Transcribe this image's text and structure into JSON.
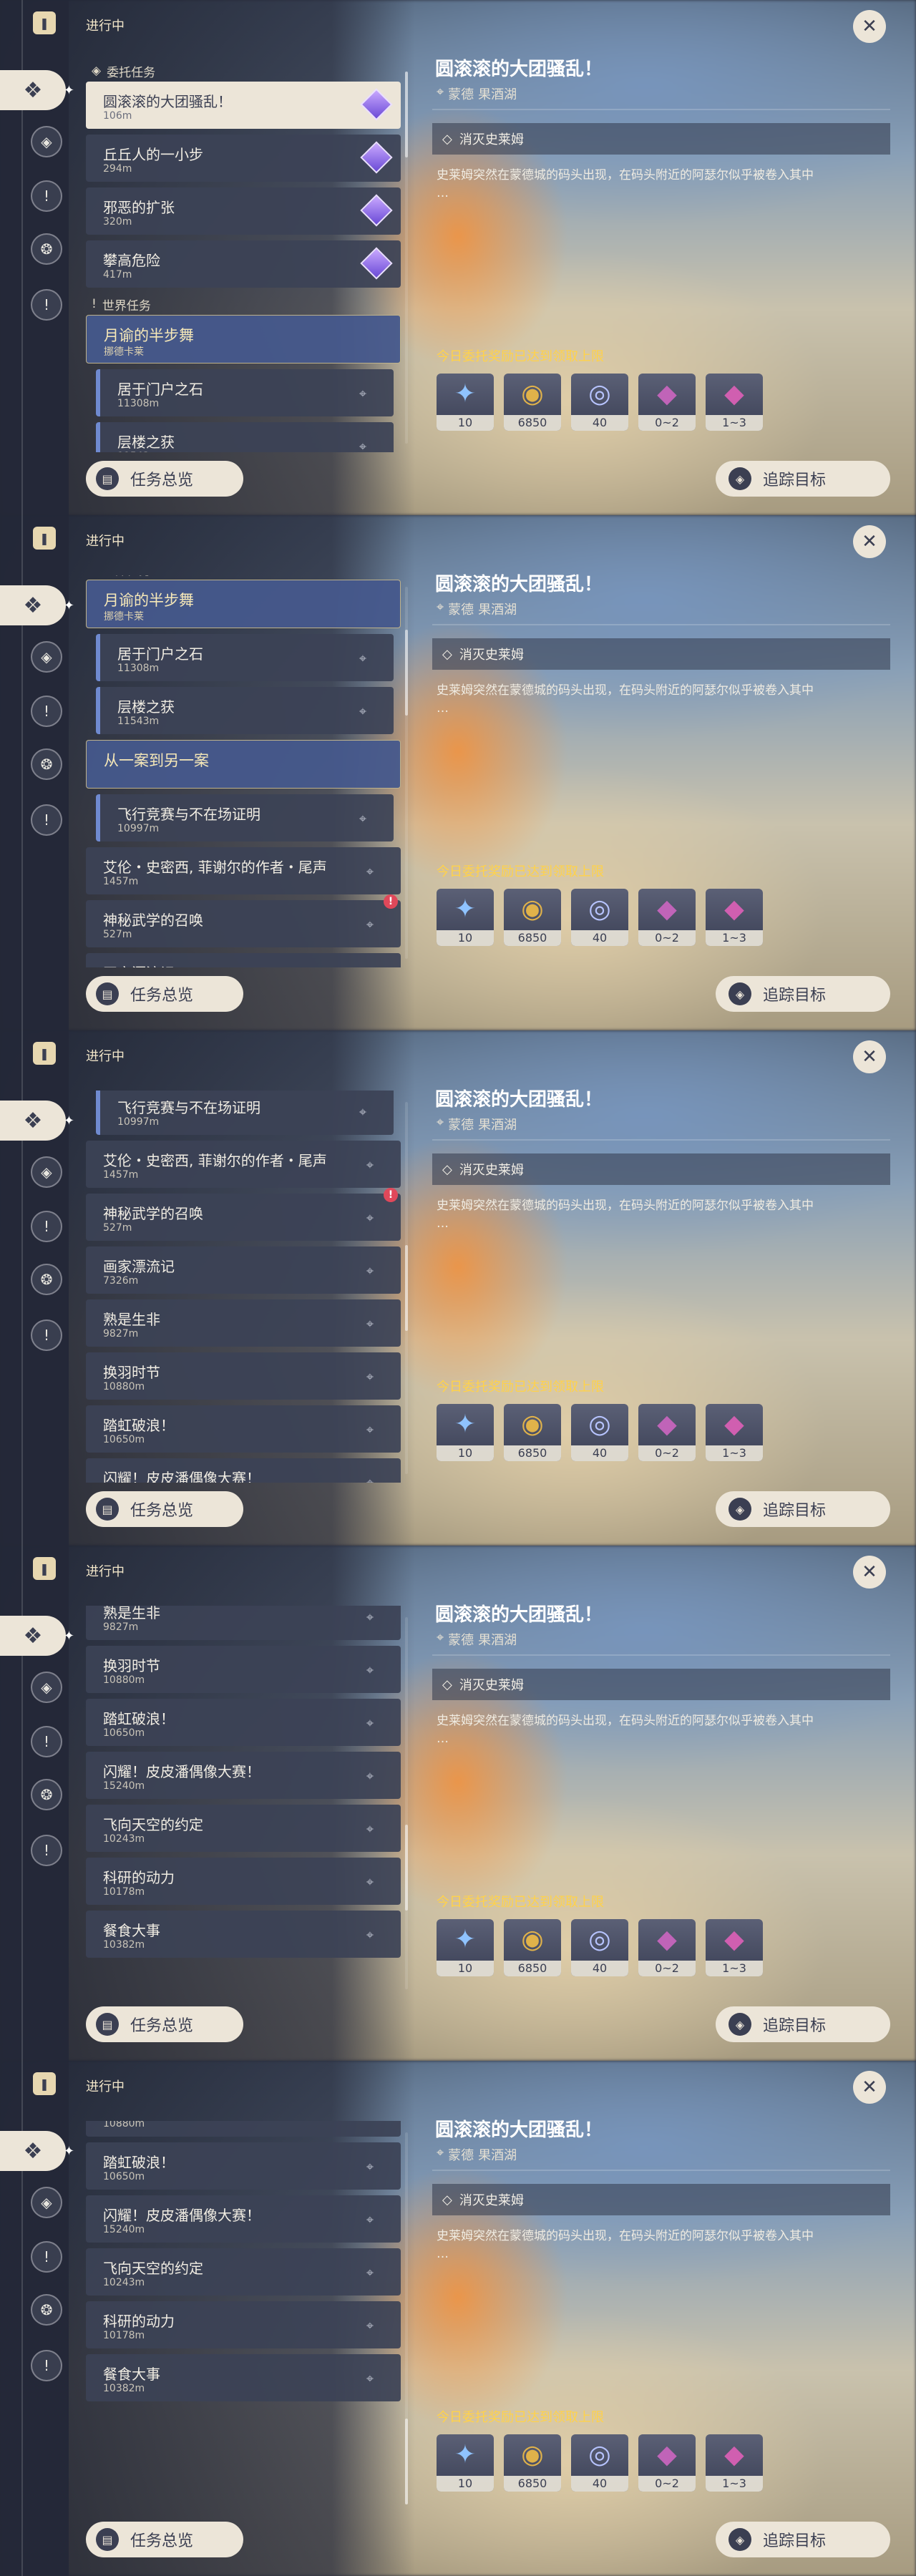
{
  "header": {
    "in_progress": "进行中",
    "close_glyph": "✕"
  },
  "rail_icons": [
    "quest-book-icon",
    "commission-icon",
    "compass-icon",
    "exclamation-icon",
    "diamond-gear-icon",
    "world-quest-icon"
  ],
  "buttons": {
    "overview": "任务总览",
    "track": "追踪目标"
  },
  "detail": {
    "title": "圆滚滚的大团骚乱！",
    "region": "蒙德",
    "place": "果酒湖",
    "objective": "消灭史莱姆",
    "description": "史莱姆突然在蒙德城的码头出现，在码头附近的阿瑟尔似乎被卷入其中",
    "description_more": "…",
    "reward_title": "今日委托奖励已达到领取上限",
    "rewards": [
      {
        "name": "adventure-exp-icon",
        "count": "10"
      },
      {
        "name": "mora-icon",
        "count": "6850"
      },
      {
        "name": "companionship-exp-icon",
        "count": "40"
      },
      {
        "name": "ore-icon",
        "count": "0~2"
      },
      {
        "name": "crystal-icon",
        "count": "1~3"
      }
    ]
  },
  "quests": {
    "commission_header": "委托任务",
    "world_header": "世界任务",
    "commission": [
      {
        "title": "圆滚滚的大团骚乱！",
        "dist": "106m"
      },
      {
        "title": "丘丘人的一小步",
        "dist": "294m"
      },
      {
        "title": "邪恶的扩张",
        "dist": "320m"
      },
      {
        "title": "攀高危险",
        "dist": "417m"
      }
    ],
    "world_group_1": {
      "title": "月谕的半步舞",
      "subtitle": "挪德卡莱"
    },
    "world_group_1_items": [
      {
        "title": "居于门户之石",
        "dist": "11308m"
      },
      {
        "title": "层楼之获",
        "dist": "11543m"
      }
    ],
    "world_group_2": {
      "title": "从一案到另一案"
    },
    "world_group_2_items": [
      {
        "title": "飞行竞赛与不在场证明",
        "dist": "10997m"
      }
    ],
    "world": [
      {
        "title": "艾伦・史密西, 菲谢尔的作者・尾声",
        "dist": "1457m"
      },
      {
        "title": "神秘武学的召唤",
        "dist": "527m"
      },
      {
        "title": "画家漂流记",
        "dist": "7326m"
      },
      {
        "title": "熟是生非",
        "dist": "9827m"
      },
      {
        "title": "换羽时节",
        "dist": "10880m"
      },
      {
        "title": "踏虹破浪！",
        "dist": "10650m"
      },
      {
        "title": "闪耀！皮皮潘偶像大赛！",
        "dist": "15240m"
      },
      {
        "title": "飞向天空的约定",
        "dist": "10243m"
      },
      {
        "title": "科研的动力",
        "dist": "10178m"
      },
      {
        "title": "餐食大事",
        "dist": "10382m"
      }
    ],
    "badge_glyph": "!"
  },
  "scroll_positions": [
    0.0,
    0.25,
    0.55,
    0.8,
    1.0
  ]
}
